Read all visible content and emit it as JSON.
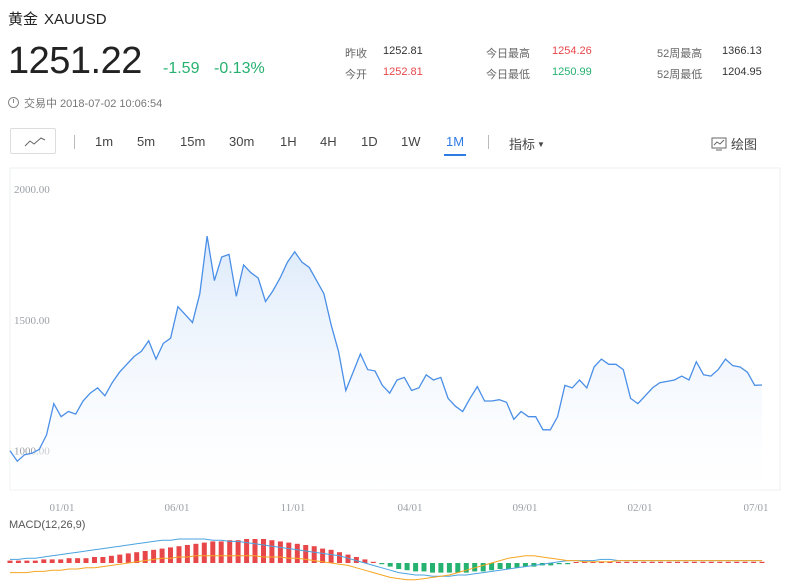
{
  "header": {
    "name": "黄金",
    "symbol": "XAUUSD",
    "price": "1251.22",
    "change": "-1.59",
    "change_pct": "-0.13%",
    "status": "交易中 2018-07-02 10:06:54"
  },
  "stats": [
    {
      "label": "昨收",
      "value": "1252.81",
      "tone": "neutral"
    },
    {
      "label": "今日最高",
      "value": "1254.26",
      "tone": "up"
    },
    {
      "label": "52周最高",
      "value": "1366.13",
      "tone": "neutral"
    },
    {
      "label": "今开",
      "value": "1252.81",
      "tone": "up"
    },
    {
      "label": "今日最低",
      "value": "1250.99",
      "tone": "down"
    },
    {
      "label": "52周最低",
      "value": "1204.95",
      "tone": "neutral"
    }
  ],
  "toolbar": {
    "periods": [
      "1m",
      "5m",
      "15m",
      "30m",
      "1H",
      "4H",
      "1D",
      "1W",
      "1M"
    ],
    "active_period": "1M",
    "indicators_label": "指标",
    "draw_label": "绘图"
  },
  "colors": {
    "line": "#4a8fe7",
    "area": "#e6f0fb",
    "up": "#e8474a",
    "down": "#25b16f",
    "macd_dif": "#4aa3df",
    "macd_dea": "#f5a623"
  },
  "chart_data": {
    "type": "area",
    "y_ticks": [
      "2000.00",
      "1500.00",
      "1000.00"
    ],
    "ylim": [
      850,
      2080
    ],
    "x_ticks": [
      "01/01",
      "06/01",
      "11/01",
      "04/01",
      "09/01",
      "02/01",
      "07/01"
    ],
    "grid": false,
    "values": [
      1000,
      960,
      985,
      990,
      1005,
      1060,
      1180,
      1130,
      1150,
      1140,
      1190,
      1220,
      1240,
      1210,
      1260,
      1300,
      1330,
      1360,
      1380,
      1420,
      1350,
      1410,
      1430,
      1550,
      1520,
      1490,
      1600,
      1820,
      1650,
      1740,
      1750,
      1590,
      1710,
      1680,
      1660,
      1570,
      1610,
      1660,
      1720,
      1760,
      1720,
      1700,
      1650,
      1600,
      1480,
      1380,
      1230,
      1300,
      1370,
      1310,
      1305,
      1250,
      1220,
      1270,
      1280,
      1230,
      1240,
      1290,
      1270,
      1280,
      1200,
      1170,
      1150,
      1200,
      1245,
      1190,
      1190,
      1195,
      1185,
      1120,
      1150,
      1130,
      1130,
      1080,
      1080,
      1130,
      1250,
      1240,
      1270,
      1240,
      1320,
      1350,
      1330,
      1330,
      1310,
      1200,
      1180,
      1210,
      1240,
      1260,
      1265,
      1270,
      1285,
      1270,
      1340,
      1290,
      1285,
      1310,
      1350,
      1325,
      1320,
      1300,
      1250,
      1251
    ],
    "macd": {
      "label": "MACD(12,26,9)",
      "histogram": [
        2,
        2,
        2,
        2,
        3,
        3,
        3,
        4,
        4,
        4,
        5,
        5,
        6,
        7,
        8,
        9,
        10,
        11,
        12,
        13,
        14,
        15,
        16,
        17,
        18,
        18,
        19,
        19,
        20,
        20,
        20,
        19,
        18,
        17,
        16,
        15,
        14,
        12,
        11,
        9,
        7,
        5,
        3,
        1,
        -1,
        -3,
        -5,
        -6,
        -7,
        -7,
        -8,
        -8,
        -8,
        -8,
        -8,
        -7,
        -7,
        -6,
        -5,
        -5,
        -4,
        -3,
        -3,
        -2,
        -2,
        -1,
        -1,
        0,
        0,
        1,
        1,
        1,
        1,
        1,
        1,
        1,
        1,
        1,
        1,
        1,
        1,
        1,
        1,
        1,
        1,
        1,
        1,
        1,
        1,
        1
      ],
      "dif": [
        3,
        3,
        4,
        4,
        5,
        6,
        7,
        8,
        9,
        10,
        11,
        12,
        13,
        14,
        15,
        16,
        17,
        18,
        19,
        19,
        20,
        20,
        20,
        20,
        19,
        19,
        18,
        18,
        17,
        16,
        15,
        14,
        13,
        12,
        11,
        10,
        9,
        8,
        7,
        6,
        4,
        2,
        0,
        -2,
        -4,
        -6,
        -8,
        -9,
        -10,
        -10,
        -11,
        -11,
        -11,
        -10,
        -10,
        -9,
        -8,
        -7,
        -6,
        -5,
        -4,
        -3,
        -2,
        -1,
        0,
        1,
        2,
        2,
        2,
        2,
        3,
        3,
        2,
        2,
        2,
        2,
        2,
        2,
        2,
        2,
        2,
        2,
        2,
        2,
        2,
        2,
        2,
        2,
        2,
        2
      ],
      "dea": [
        -8,
        -8,
        -8,
        -7,
        -7,
        -6,
        -6,
        -5,
        -5,
        -4,
        -4,
        -3,
        -2,
        -1,
        0,
        1,
        2,
        3,
        4,
        4,
        5,
        5,
        6,
        6,
        6,
        6,
        6,
        6,
        6,
        6,
        5,
        5,
        5,
        4,
        4,
        3,
        2,
        1,
        0,
        -1,
        -2,
        -4,
        -6,
        -8,
        -10,
        -12,
        -13,
        -14,
        -14,
        -13,
        -12,
        -11,
        -10,
        -8,
        -6,
        -4,
        -2,
        0,
        2,
        4,
        5,
        6,
        6,
        5,
        4,
        3,
        2,
        2,
        1,
        1,
        1,
        1,
        2,
        2,
        2,
        2,
        2,
        2,
        2,
        2,
        2,
        2,
        2,
        2,
        2,
        2,
        2,
        2,
        2,
        2
      ]
    }
  }
}
